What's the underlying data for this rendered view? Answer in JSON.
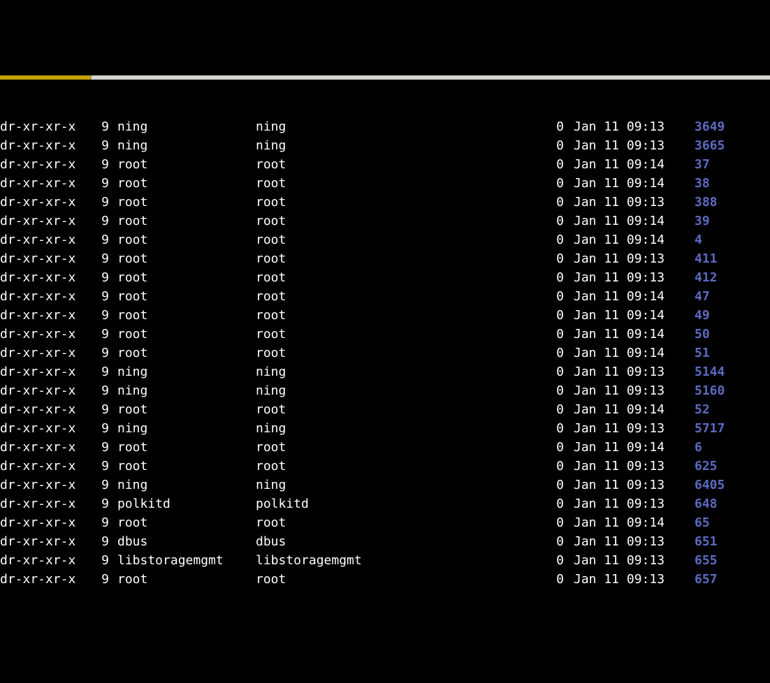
{
  "rows": [
    {
      "perms": "dr-xr-xr-x",
      "links": "9",
      "owner": "ning",
      "group": "ning",
      "size": "0",
      "date": "Jan 11 09:13",
      "name": "3649"
    },
    {
      "perms": "dr-xr-xr-x",
      "links": "9",
      "owner": "ning",
      "group": "ning",
      "size": "0",
      "date": "Jan 11 09:13",
      "name": "3665"
    },
    {
      "perms": "dr-xr-xr-x",
      "links": "9",
      "owner": "root",
      "group": "root",
      "size": "0",
      "date": "Jan 11 09:14",
      "name": "37"
    },
    {
      "perms": "dr-xr-xr-x",
      "links": "9",
      "owner": "root",
      "group": "root",
      "size": "0",
      "date": "Jan 11 09:14",
      "name": "38"
    },
    {
      "perms": "dr-xr-xr-x",
      "links": "9",
      "owner": "root",
      "group": "root",
      "size": "0",
      "date": "Jan 11 09:13",
      "name": "388"
    },
    {
      "perms": "dr-xr-xr-x",
      "links": "9",
      "owner": "root",
      "group": "root",
      "size": "0",
      "date": "Jan 11 09:14",
      "name": "39"
    },
    {
      "perms": "dr-xr-xr-x",
      "links": "9",
      "owner": "root",
      "group": "root",
      "size": "0",
      "date": "Jan 11 09:14",
      "name": "4"
    },
    {
      "perms": "dr-xr-xr-x",
      "links": "9",
      "owner": "root",
      "group": "root",
      "size": "0",
      "date": "Jan 11 09:13",
      "name": "411"
    },
    {
      "perms": "dr-xr-xr-x",
      "links": "9",
      "owner": "root",
      "group": "root",
      "size": "0",
      "date": "Jan 11 09:13",
      "name": "412"
    },
    {
      "perms": "dr-xr-xr-x",
      "links": "9",
      "owner": "root",
      "group": "root",
      "size": "0",
      "date": "Jan 11 09:14",
      "name": "47"
    },
    {
      "perms": "dr-xr-xr-x",
      "links": "9",
      "owner": "root",
      "group": "root",
      "size": "0",
      "date": "Jan 11 09:14",
      "name": "49"
    },
    {
      "perms": "dr-xr-xr-x",
      "links": "9",
      "owner": "root",
      "group": "root",
      "size": "0",
      "date": "Jan 11 09:14",
      "name": "50"
    },
    {
      "perms": "dr-xr-xr-x",
      "links": "9",
      "owner": "root",
      "group": "root",
      "size": "0",
      "date": "Jan 11 09:14",
      "name": "51"
    },
    {
      "perms": "dr-xr-xr-x",
      "links": "9",
      "owner": "ning",
      "group": "ning",
      "size": "0",
      "date": "Jan 11 09:13",
      "name": "5144"
    },
    {
      "perms": "dr-xr-xr-x",
      "links": "9",
      "owner": "ning",
      "group": "ning",
      "size": "0",
      "date": "Jan 11 09:13",
      "name": "5160"
    },
    {
      "perms": "dr-xr-xr-x",
      "links": "9",
      "owner": "root",
      "group": "root",
      "size": "0",
      "date": "Jan 11 09:14",
      "name": "52"
    },
    {
      "perms": "dr-xr-xr-x",
      "links": "9",
      "owner": "ning",
      "group": "ning",
      "size": "0",
      "date": "Jan 11 09:13",
      "name": "5717"
    },
    {
      "perms": "dr-xr-xr-x",
      "links": "9",
      "owner": "root",
      "group": "root",
      "size": "0",
      "date": "Jan 11 09:14",
      "name": "6"
    },
    {
      "perms": "dr-xr-xr-x",
      "links": "9",
      "owner": "root",
      "group": "root",
      "size": "0",
      "date": "Jan 11 09:13",
      "name": "625"
    },
    {
      "perms": "dr-xr-xr-x",
      "links": "9",
      "owner": "ning",
      "group": "ning",
      "size": "0",
      "date": "Jan 11 09:13",
      "name": "6405"
    },
    {
      "perms": "dr-xr-xr-x",
      "links": "9",
      "owner": "polkitd",
      "group": "polkitd",
      "size": "0",
      "date": "Jan 11 09:13",
      "name": "648"
    },
    {
      "perms": "dr-xr-xr-x",
      "links": "9",
      "owner": "root",
      "group": "root",
      "size": "0",
      "date": "Jan 11 09:14",
      "name": "65"
    },
    {
      "perms": "dr-xr-xr-x",
      "links": "9",
      "owner": "dbus",
      "group": "dbus",
      "size": "0",
      "date": "Jan 11 09:13",
      "name": "651"
    },
    {
      "perms": "dr-xr-xr-x",
      "links": "9",
      "owner": "libstoragemgmt",
      "group": "libstoragemgmt",
      "size": "0",
      "date": "Jan 11 09:13",
      "name": "655"
    },
    {
      "perms": "dr-xr-xr-x",
      "links": "9",
      "owner": "root",
      "group": "root",
      "size": "0",
      "date": "Jan 11 09:13",
      "name": "657"
    }
  ]
}
